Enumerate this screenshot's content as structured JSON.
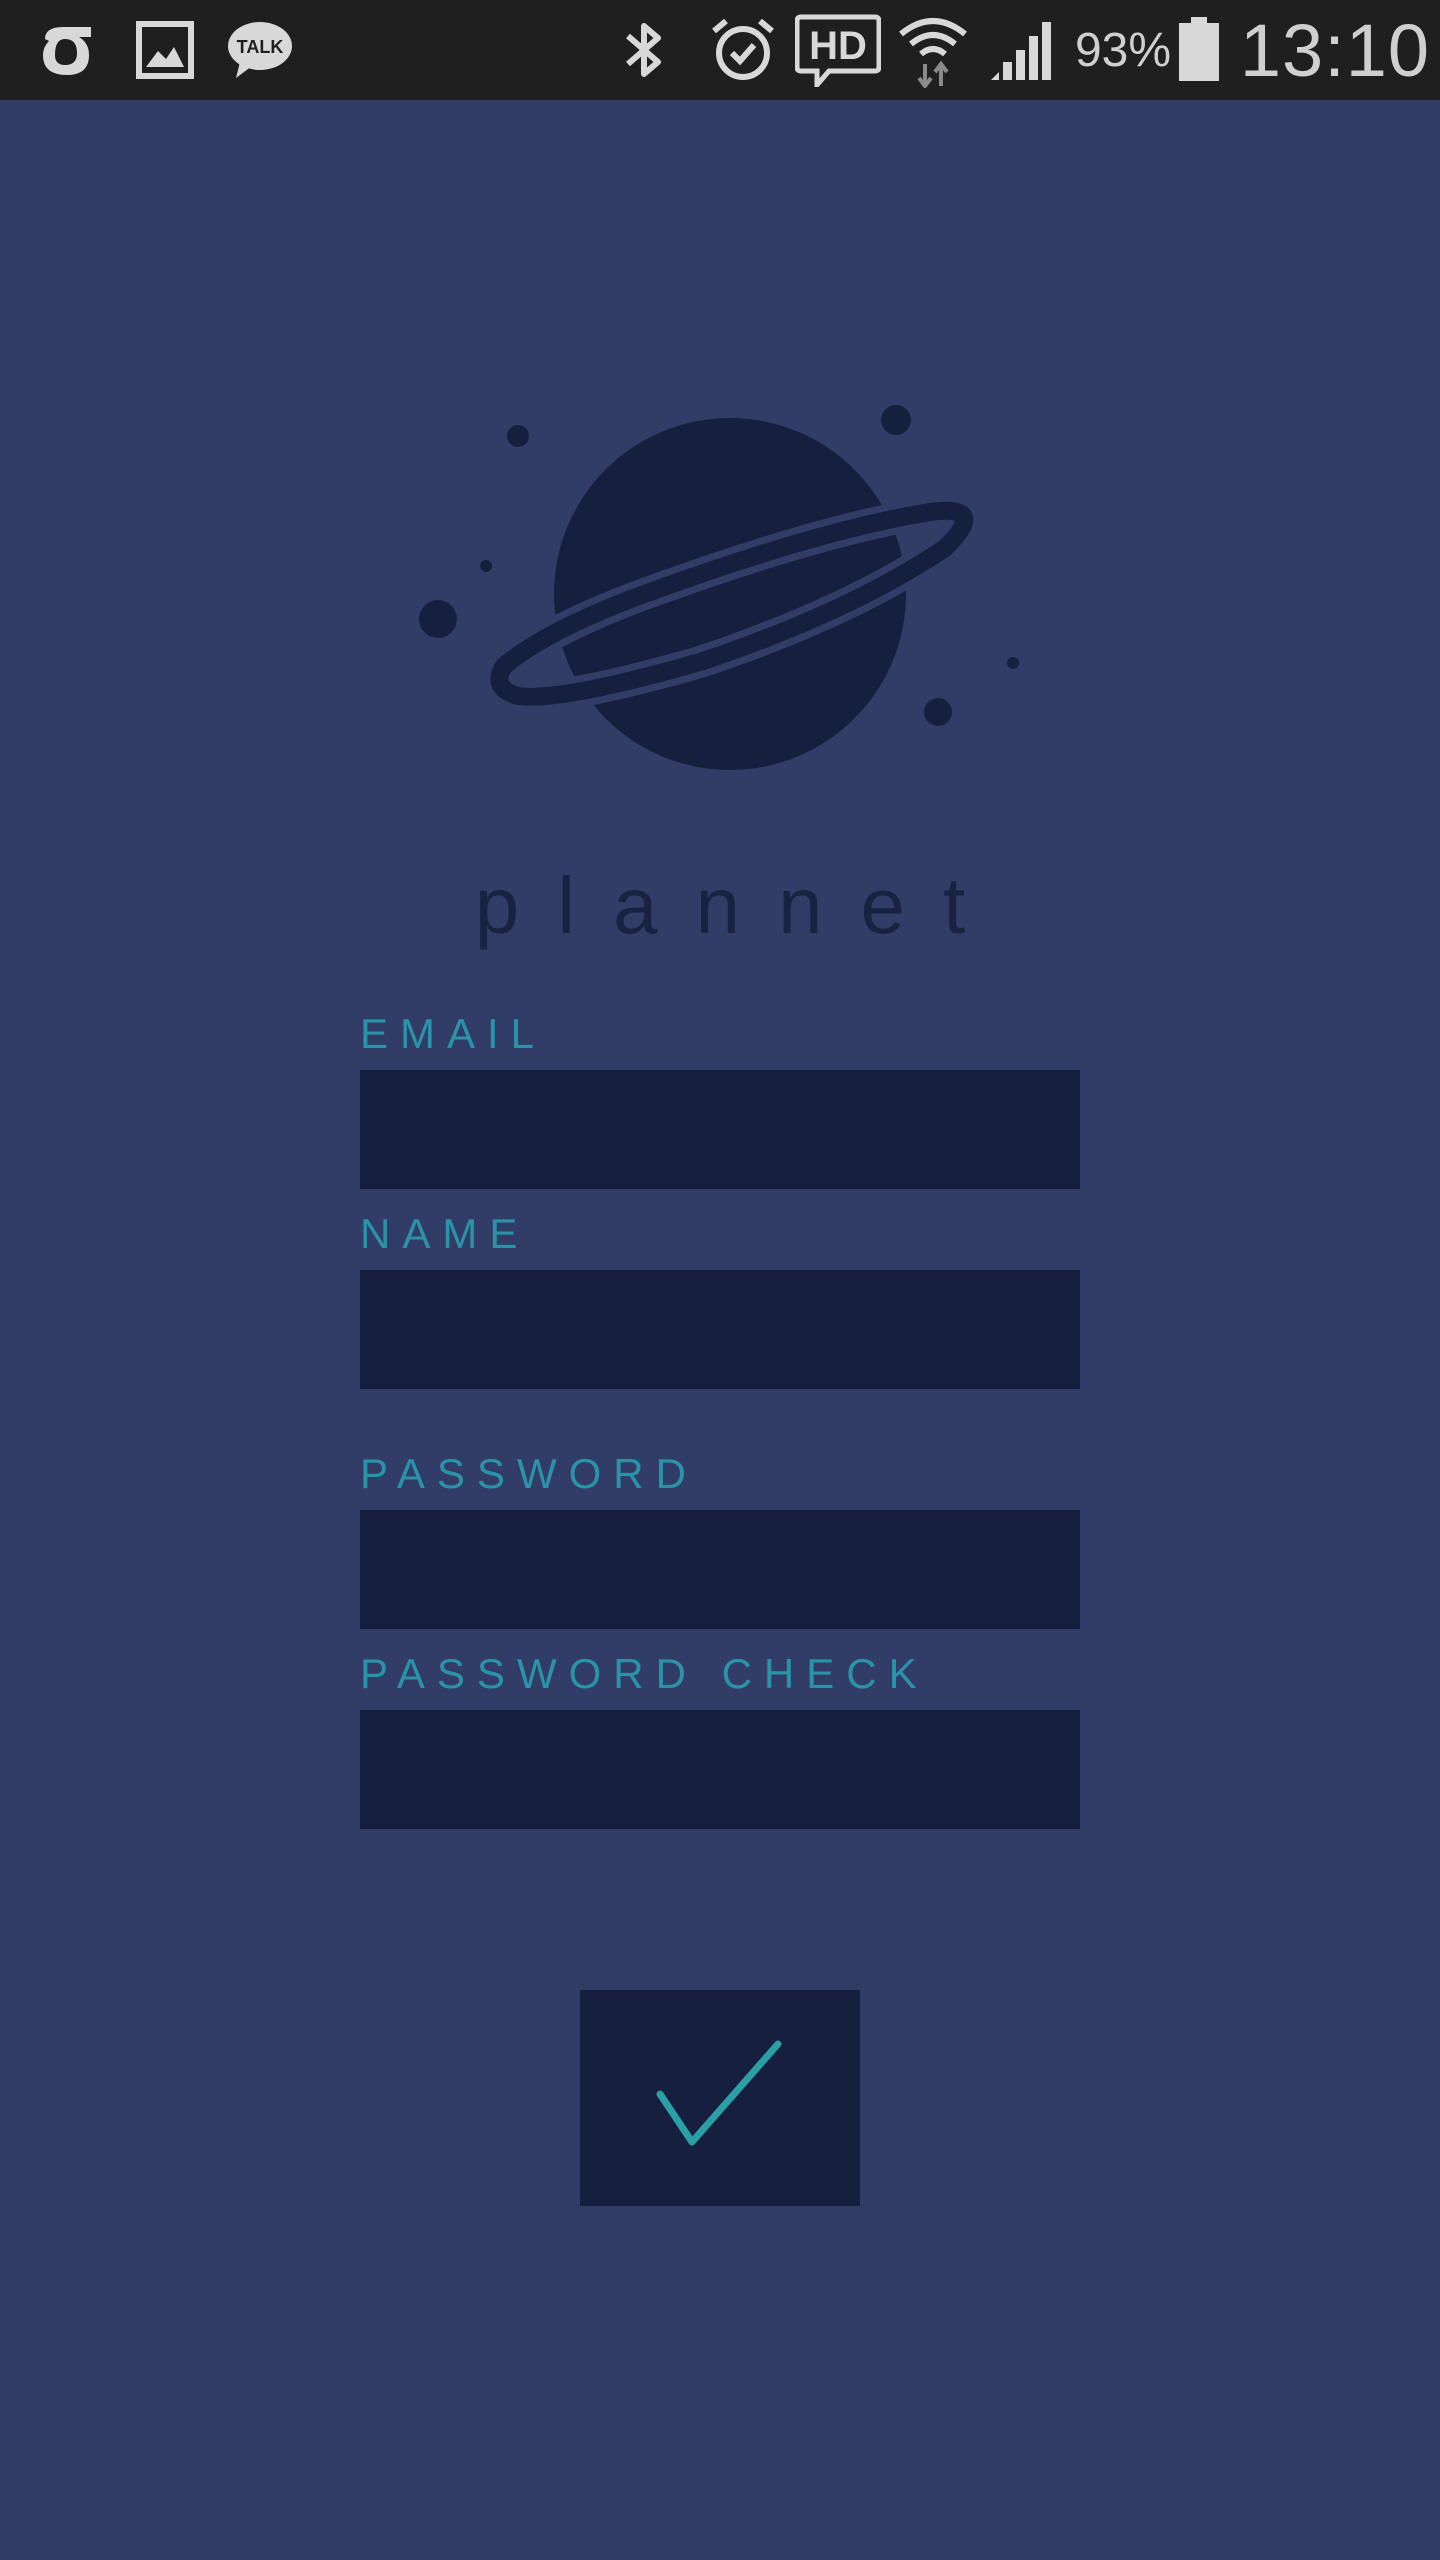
{
  "status_bar": {
    "icons": [
      "notification-app-icon",
      "gallery-icon",
      "kakaotalk-icon",
      "bluetooth-icon",
      "alarm-icon",
      "hd-voice-icon",
      "wifi-icon",
      "signal-icon",
      "battery-icon"
    ],
    "talk_label": "TALK",
    "hd_label": "HD",
    "battery_percent": "93%",
    "time": "13:10"
  },
  "brand": {
    "logo_icon": "planet-logo-icon",
    "name": "plannet"
  },
  "form": {
    "email_label": "EMAIL",
    "name_label": "NAME",
    "password_label": "PASSWORD",
    "password_check_label": "PASSWORD CHECK",
    "submit_icon": "checkmark-icon"
  },
  "colors": {
    "background": "#323d67",
    "field_background": "#171f3e",
    "accent": "#2a93a8",
    "status_bar": "#1f1f1f"
  }
}
